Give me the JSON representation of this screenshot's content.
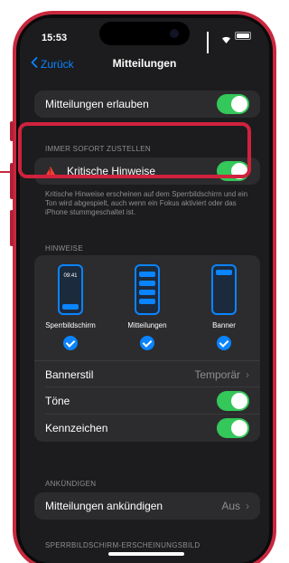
{
  "status_bar": {
    "time": "15:53"
  },
  "nav": {
    "back_label": "Zurück",
    "title": "Mitteilungen"
  },
  "allow": {
    "label": "Mitteilungen erlauben",
    "on": true
  },
  "immediate": {
    "header": "IMMER SOFORT ZUSTELLEN",
    "critical_label": "Kritische Hinweise",
    "critical_on": true,
    "footnote": "Kritische Hinweise erscheinen auf dem Sperr­bildschirm und ein Ton wird abgespielt, auch wenn ein Fokus aktiviert oder das iPhone stummgeschaltet ist."
  },
  "alerts": {
    "header": "HINWEISE",
    "styles": [
      {
        "label": "Sperrbildschirm",
        "clock": "09:41",
        "checked": true
      },
      {
        "label": "Mitteilungen",
        "checked": true
      },
      {
        "label": "Banner",
        "checked": true
      }
    ],
    "banner_style_label": "Bannerstil",
    "banner_style_value": "Temporär",
    "sounds_label": "Töne",
    "sounds_on": true,
    "badges_label": "Kennzeichen",
    "badges_on": true
  },
  "announce": {
    "header": "ANKÜNDIGEN",
    "label": "Mitteilungen ankündigen",
    "value": "Aus"
  },
  "lockscreen_header": "SPERRBILDSCHIRM-ERSCHEINUNGSBILD",
  "colors": {
    "frame": "#c8283f",
    "highlight": "#d0223d",
    "toggle_on": "#34c759",
    "accent": "#0a84ff",
    "warning": "#ff3b30"
  }
}
